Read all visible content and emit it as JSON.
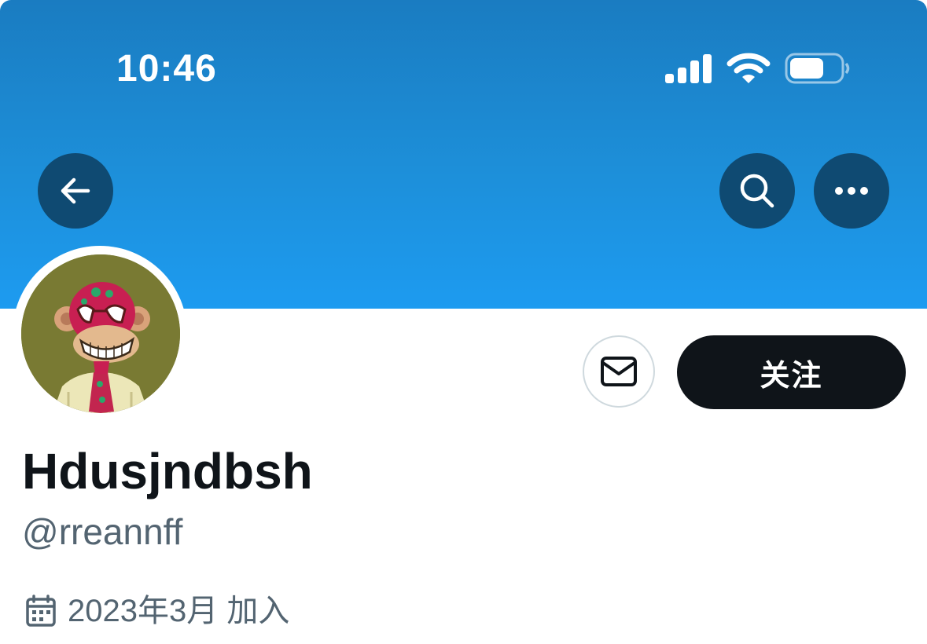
{
  "status_bar": {
    "time": "10:46",
    "signal_icon": "cellular-signal-icon",
    "wifi_icon": "wifi-icon",
    "battery_icon": "battery-icon"
  },
  "nav": {
    "back_icon": "arrow-left-icon",
    "search_icon": "search-icon",
    "more_icon": "more-horizontal-icon"
  },
  "profile": {
    "display_name": "Hdusjndbsh",
    "handle": "@rreannff",
    "joined_icon": "calendar-icon",
    "joined": "2023年3月 加入"
  },
  "actions": {
    "message_icon": "mail-icon",
    "follow_label": "关注"
  },
  "colors": {
    "banner": "#1d9bf0",
    "nav_button": "#0f4a72",
    "follow_button": "#0f1419",
    "secondary_text": "#536471",
    "avatar_bg": "#797a33"
  }
}
